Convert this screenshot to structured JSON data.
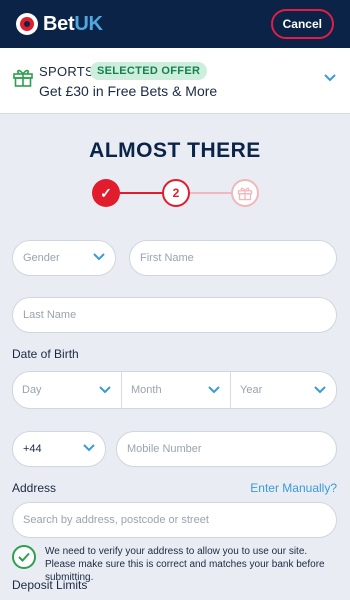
{
  "header": {
    "logo_bet": "Bet",
    "logo_uk": "UK",
    "cancel_label": "Cancel"
  },
  "offer": {
    "category": "SPORTS",
    "badge": "SELECTED OFFER",
    "text": "Get £30 in Free Bets & More"
  },
  "title": "ALMOST THERE",
  "stepper": {
    "step1": "✓",
    "step2": "2"
  },
  "form": {
    "gender_placeholder": "Gender",
    "first_name_placeholder": "First Name",
    "last_name_placeholder": "Last Name",
    "dob_label": "Date of Birth",
    "day_placeholder": "Day",
    "month_placeholder": "Month",
    "year_placeholder": "Year",
    "phone_prefix": "+44",
    "mobile_placeholder": "Mobile Number",
    "address_label": "Address",
    "enter_manually": "Enter Manually?",
    "address_placeholder": "Search by address, postcode or street",
    "verify_text": "We need to verify your address to allow you to use our site. Please make sure this is correct and matches your bank before submitting.",
    "deposit_label": "Deposit Limits"
  },
  "colors": {
    "brand_navy": "#0b2347",
    "accent_red": "#e11d2d",
    "link_blue": "#3a9ad9",
    "success_green": "#2e9e4f"
  }
}
